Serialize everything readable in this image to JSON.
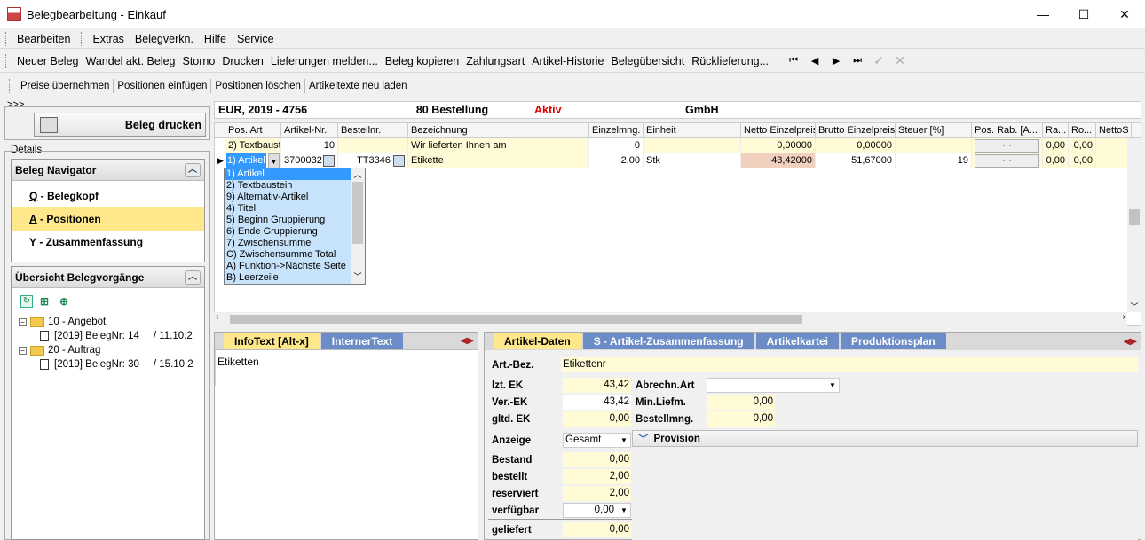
{
  "window": {
    "title": "Belegbearbeitung - Einkauf",
    "minimize": "—",
    "maximize": "☐",
    "close": "✕"
  },
  "menu": [
    "Bearbeiten",
    "Extras",
    "Belegverkn.",
    "Hilfe",
    "Service"
  ],
  "toolbar1": [
    "Neuer Beleg",
    "Wandel akt. Beleg",
    "Storno",
    "Drucken",
    "Lieferungen melden...",
    "Beleg kopieren",
    "Zahlungsart",
    "Artikel-Historie",
    "Belegübersicht",
    "Rücklieferung..."
  ],
  "toolbar1_nav": [
    "⏮",
    "◀",
    "▶",
    "⏭",
    "✓",
    "✕"
  ],
  "toolbar2": [
    "Preise übernehmen",
    "Positionen einfügen",
    "Positionen löschen",
    "Artikeltexte neu laden"
  ],
  "left": {
    "chevrons": ">>>",
    "print_label": "Beleg drucken",
    "details_label": "Details",
    "navigator_title": "Beleg Navigator",
    "nav_items": [
      {
        "key": "Q",
        "label": "Belegkopf"
      },
      {
        "key": "A",
        "label": "Positionen"
      },
      {
        "key": "Y",
        "label": "Zusammenfassung"
      }
    ],
    "overview_title": "Übersicht Belegvorgänge",
    "tree": {
      "angebot": "10 - Angebot",
      "angebot_doc": "[2019] BelegNr: 14     / 11.10.2",
      "auftrag": "20 - Auftrag",
      "auftrag_doc": "[2019] BelegNr: 30     / 15.10.2"
    }
  },
  "infobar": {
    "currency": "EUR, 2019 - 4756",
    "type": "80 Bestellung",
    "status": "Aktiv",
    "company": "GmbH",
    "status_color": "#e00000"
  },
  "grid": {
    "headers": [
      "Pos. Art",
      "Artikel-Nr.",
      "Bestellnr.",
      "Bezeichnung",
      "Einzelmng.",
      "Einheit",
      "Netto Einzelpreis",
      "Brutto Einzelpreis",
      "Steuer [%]",
      "Pos. Rab. [A...",
      "Ra...",
      "Ro...",
      "NettoS"
    ],
    "rows": [
      {
        "posart": "2) Textbaust",
        "artnr": "10",
        "bestellnr": "",
        "bez": "Wir lieferten Ihnen am",
        "menge": "0",
        "einheit": "",
        "netto": "0,00000",
        "brutto": "0,00000",
        "steuer": "",
        "rab": "···",
        "ra": "0,00",
        "ro": "0,00"
      },
      {
        "posart": "1) Artikel",
        "artnr": "3700032",
        "bestellnr": "TT3346",
        "bez": "Etikette",
        "menge": "2,00",
        "einheit": "Stk",
        "netto": "43,42000",
        "brutto": "51,67000",
        "steuer": "19",
        "rab": "···",
        "ra": "0,00",
        "ro": "0,00"
      }
    ],
    "dropdown": [
      "1) Artikel",
      "2) Textbaustein",
      "9) Alternativ-Artikel",
      "4) Titel",
      "5) Beginn Gruppierung",
      "6) Ende Gruppierung",
      "7) Zwischensumme",
      "C) Zwischensumme Total",
      "A) Funktion->Nächste Seite",
      "B) Leerzeile"
    ]
  },
  "infotext": {
    "tabs": [
      "InfoText [Alt-x]",
      "InternerText"
    ],
    "content": "Etiketten"
  },
  "artikel": {
    "tabs": [
      "Artikel-Daten",
      "S - Artikel-Zusammenfassung",
      "Artikelkartei",
      "Produktionsplan"
    ],
    "bez_label": "Art.-Bez.",
    "bez": "Etikettenr",
    "lzt_ek_label": "lzt. EK",
    "lzt_ek": "43,42",
    "ver_ek_label": "Ver.-EK",
    "ver_ek": "43,42",
    "gltd_ek_label": "gltd. EK",
    "gltd_ek": "0,00",
    "abrechn_label": "Abrechn.Art",
    "abrechn": "",
    "minliefm_label": "Min.Liefm.",
    "minliefm": "0,00",
    "bestellmng_label": "Bestellmng.",
    "bestellmng": "0,00",
    "anzeige_label": "Anzeige",
    "anzeige": "Gesamt",
    "provision_label": "Provision",
    "bestand_label": "Bestand",
    "bestand": "0,00",
    "bestellt_label": "bestellt",
    "bestellt": "2,00",
    "reserviert_label": "reserviert",
    "reserviert": "2,00",
    "verfuegbar_label": "verfügbar",
    "verfuegbar": "0,00",
    "geliefert_label": "geliefert",
    "geliefert": "0,00"
  }
}
